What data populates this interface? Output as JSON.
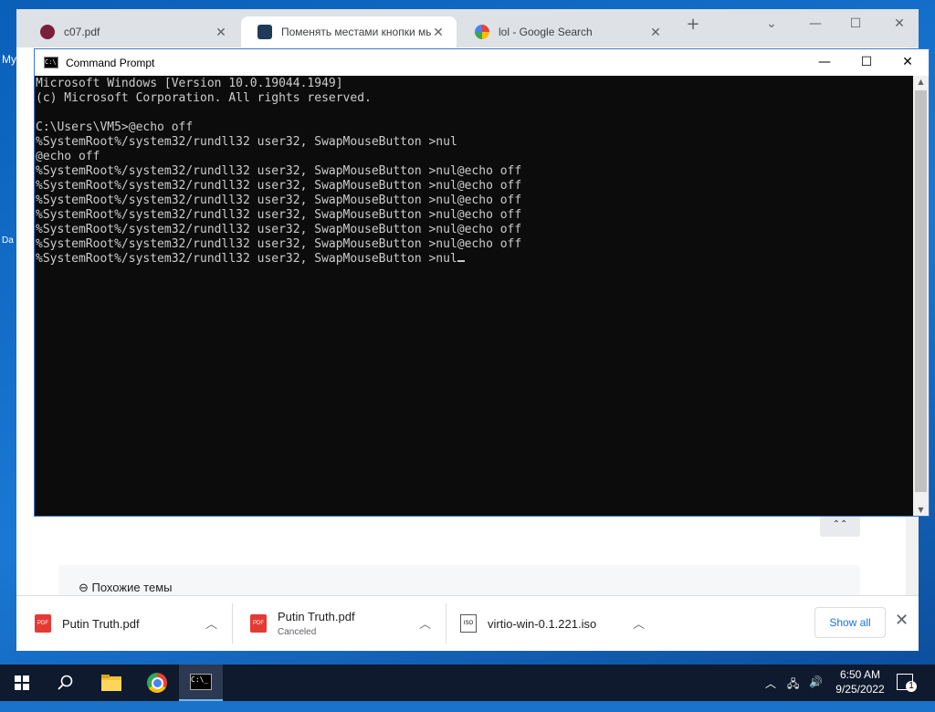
{
  "desktop": {
    "icon_labels": [
      "My",
      "Da"
    ]
  },
  "browser": {
    "tabs": [
      {
        "title": "c07.pdf",
        "active": false
      },
      {
        "title": "Поменять местами кнопки мыш",
        "active": true
      },
      {
        "title": "lol - Google Search",
        "active": false
      }
    ],
    "new_tab": "+",
    "controls": {
      "dropdown": "⌄",
      "minimize": "—",
      "maximize": "☐",
      "close": "✕"
    },
    "page": {
      "scroll_top_glyph": "⌃⌃",
      "similar_topics": "⊖ Похожие темы"
    },
    "downloads": {
      "items": [
        {
          "name": "Putin Truth.pdf",
          "status": "",
          "type": "PDF"
        },
        {
          "name": "Putin Truth.pdf",
          "status": "Canceled",
          "type": "PDF"
        },
        {
          "name": "virtio-win-0.1.221.iso",
          "status": "",
          "type": "ISO"
        }
      ],
      "show_all": "Show all",
      "close": "✕"
    }
  },
  "cmd": {
    "title": "Command Prompt",
    "controls": {
      "minimize": "—",
      "maximize": "☐",
      "close": "✕"
    },
    "lines": [
      "Microsoft Windows [Version 10.0.19044.1949]",
      "(c) Microsoft Corporation. All rights reserved.",
      "",
      "C:\\Users\\VM5>@echo off",
      "%SystemRoot%/system32/rundll32 user32, SwapMouseButton >nul",
      "@echo off",
      "%SystemRoot%/system32/rundll32 user32, SwapMouseButton >nul@echo off",
      "%SystemRoot%/system32/rundll32 user32, SwapMouseButton >nul@echo off",
      "%SystemRoot%/system32/rundll32 user32, SwapMouseButton >nul@echo off",
      "%SystemRoot%/system32/rundll32 user32, SwapMouseButton >nul@echo off",
      "%SystemRoot%/system32/rundll32 user32, SwapMouseButton >nul@echo off",
      "%SystemRoot%/system32/rundll32 user32, SwapMouseButton >nul@echo off",
      "%SystemRoot%/system32/rundll32 user32, SwapMouseButton >nul"
    ]
  },
  "taskbar": {
    "time": "6:50 AM",
    "date": "9/25/2022",
    "notification_count": "1"
  }
}
